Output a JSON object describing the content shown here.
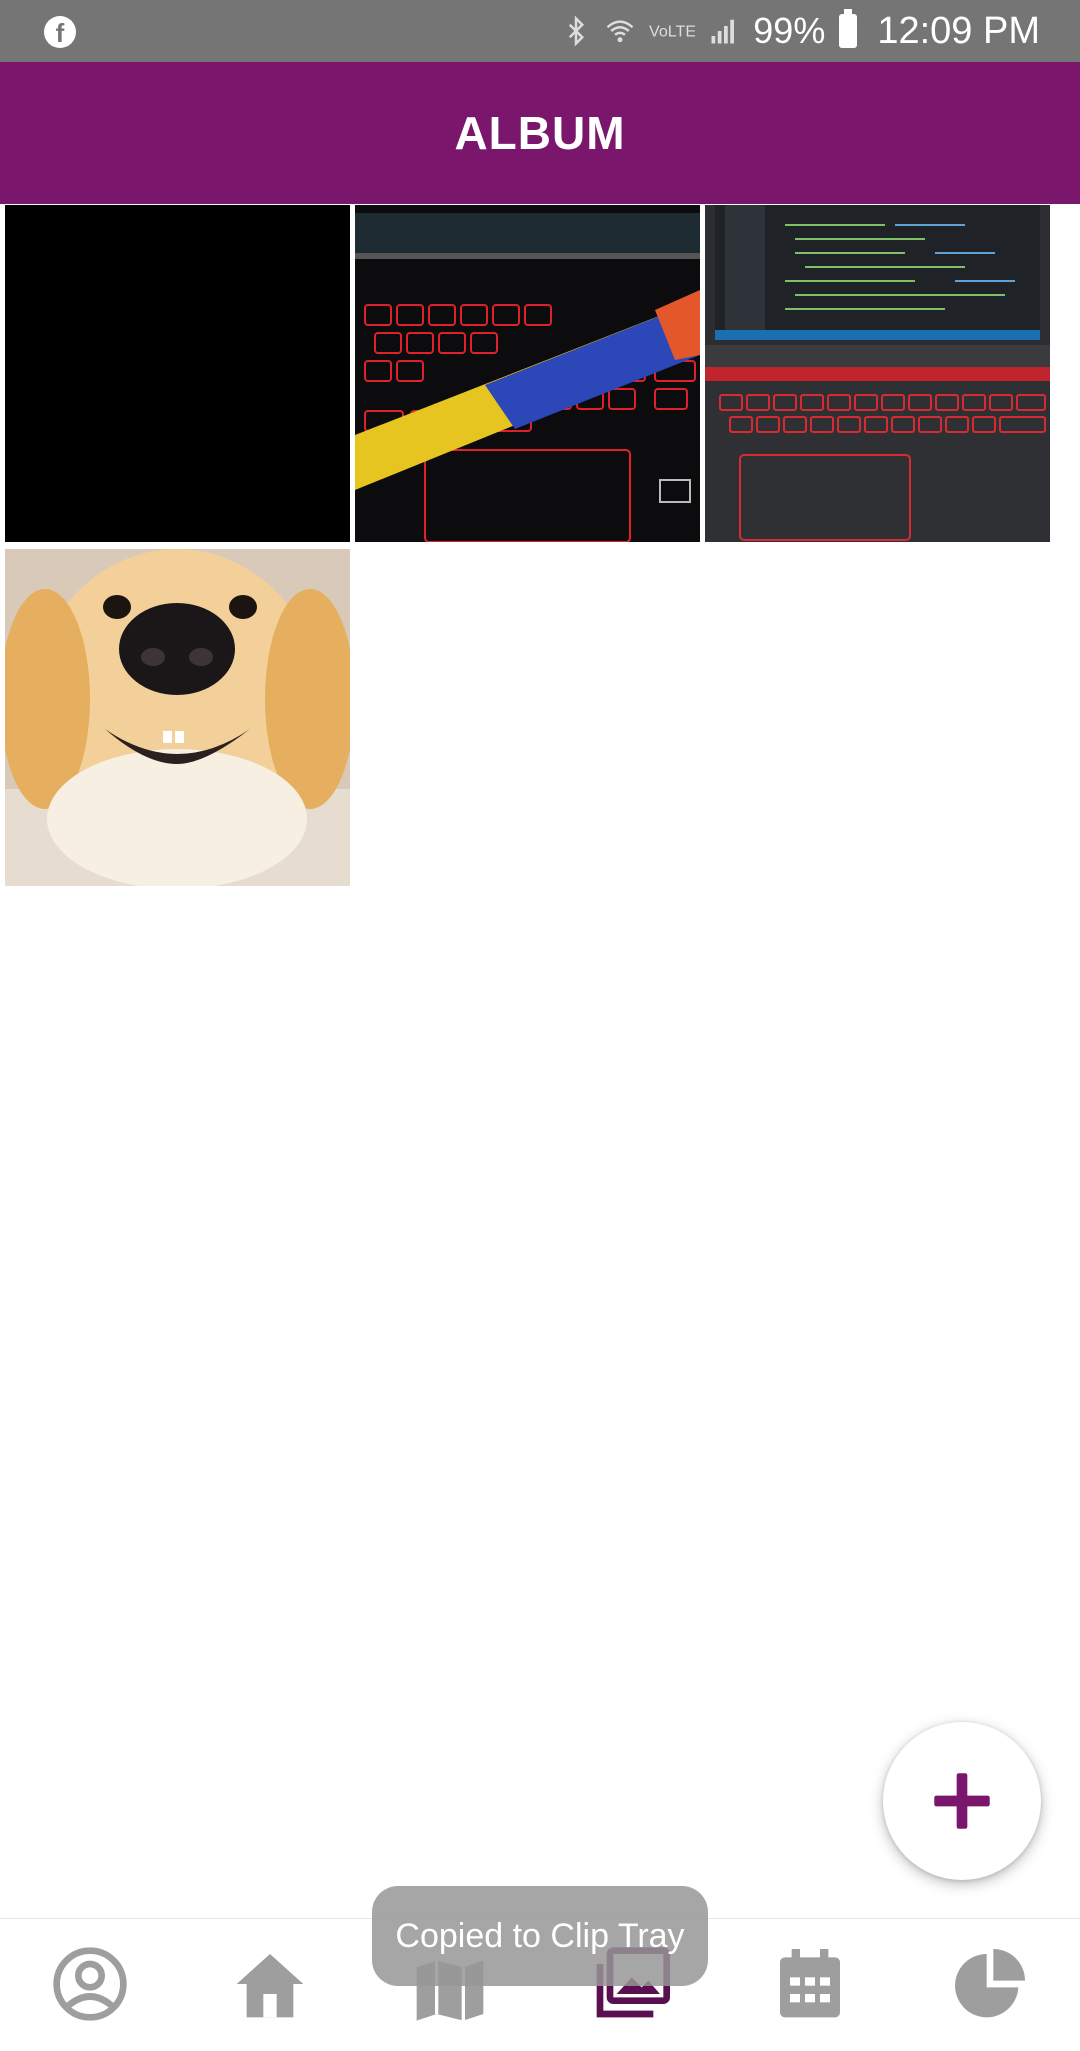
{
  "status_bar": {
    "battery": "99%",
    "time": "12:09 PM",
    "icons": [
      "facebook-icon",
      "bluetooth-icon",
      "wifi-icon",
      "volte-icon",
      "signal-icon",
      "battery-icon"
    ]
  },
  "app_bar": {
    "title": "ALBUM",
    "color": "#7a166c"
  },
  "gallery": {
    "photos": [
      {
        "name": "photo-black"
      },
      {
        "name": "photo-keyboard-pen"
      },
      {
        "name": "photo-laptop-code"
      },
      {
        "name": "photo-dog"
      }
    ]
  },
  "fab": {
    "icon": "plus-icon",
    "color": "#7a166c"
  },
  "bottom_nav": {
    "items": [
      {
        "icon": "profile-icon",
        "active": false
      },
      {
        "icon": "home-icon",
        "active": false
      },
      {
        "icon": "map-icon",
        "active": false
      },
      {
        "icon": "album-icon",
        "active": true
      },
      {
        "icon": "calendar-icon",
        "active": false
      },
      {
        "icon": "pie-chart-icon",
        "active": false
      }
    ],
    "active_color": "#5a0f50",
    "inactive_color": "#9e9e9e"
  },
  "toast": {
    "text": "Copied to Clip Tray"
  }
}
